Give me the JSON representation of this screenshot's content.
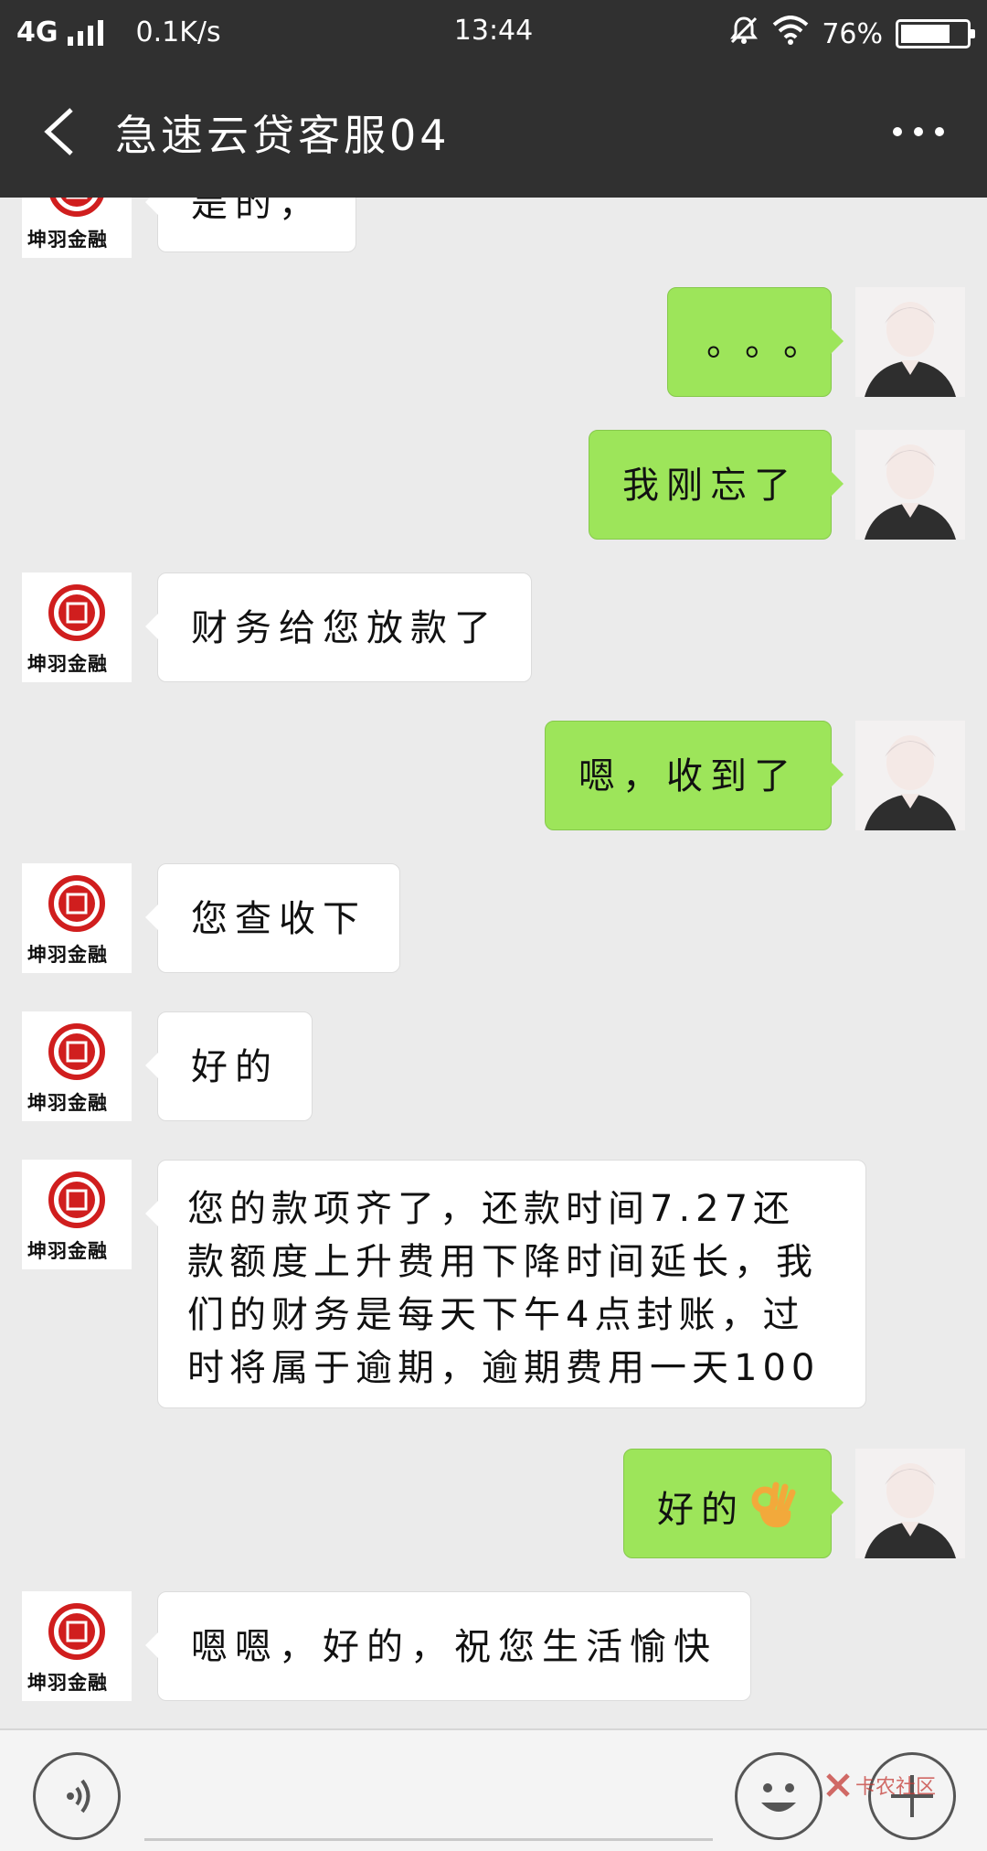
{
  "status_bar": {
    "network": "4G",
    "speed": "0.1K/s",
    "time": "13:44",
    "battery": "76%",
    "battery_level": 0.76
  },
  "header": {
    "title": "急速云贷客服04"
  },
  "contact": {
    "avatar_text": "坤羽金融"
  },
  "messages": [
    {
      "side": "left",
      "text": "是的，"
    },
    {
      "side": "right",
      "text": "。。。"
    },
    {
      "side": "right",
      "text": "我刚忘了"
    },
    {
      "side": "left",
      "text": "财务给您放款了"
    },
    {
      "side": "right",
      "text": "嗯，收到了"
    },
    {
      "side": "left",
      "text": "您查收下"
    },
    {
      "side": "left",
      "text": "好的"
    },
    {
      "side": "left",
      "text": "您的款项齐了，还款时间7.27还款额度上升费用下降时间延长，我们的财务是每天下午4点封账，过时将属于逾期，逾期费用一天100"
    },
    {
      "side": "right",
      "text": "好的",
      "emoji": "ok-hand"
    },
    {
      "side": "left",
      "text": "嗯嗯，好的，祝您生活愉快"
    }
  ],
  "watermark": "卡农社区",
  "colors": {
    "header_bg": "#303030",
    "chat_bg": "#ebebeb",
    "sent_bubble": "#9de55a",
    "received_bubble": "#ffffff",
    "logo_red": "#d01e1e"
  }
}
